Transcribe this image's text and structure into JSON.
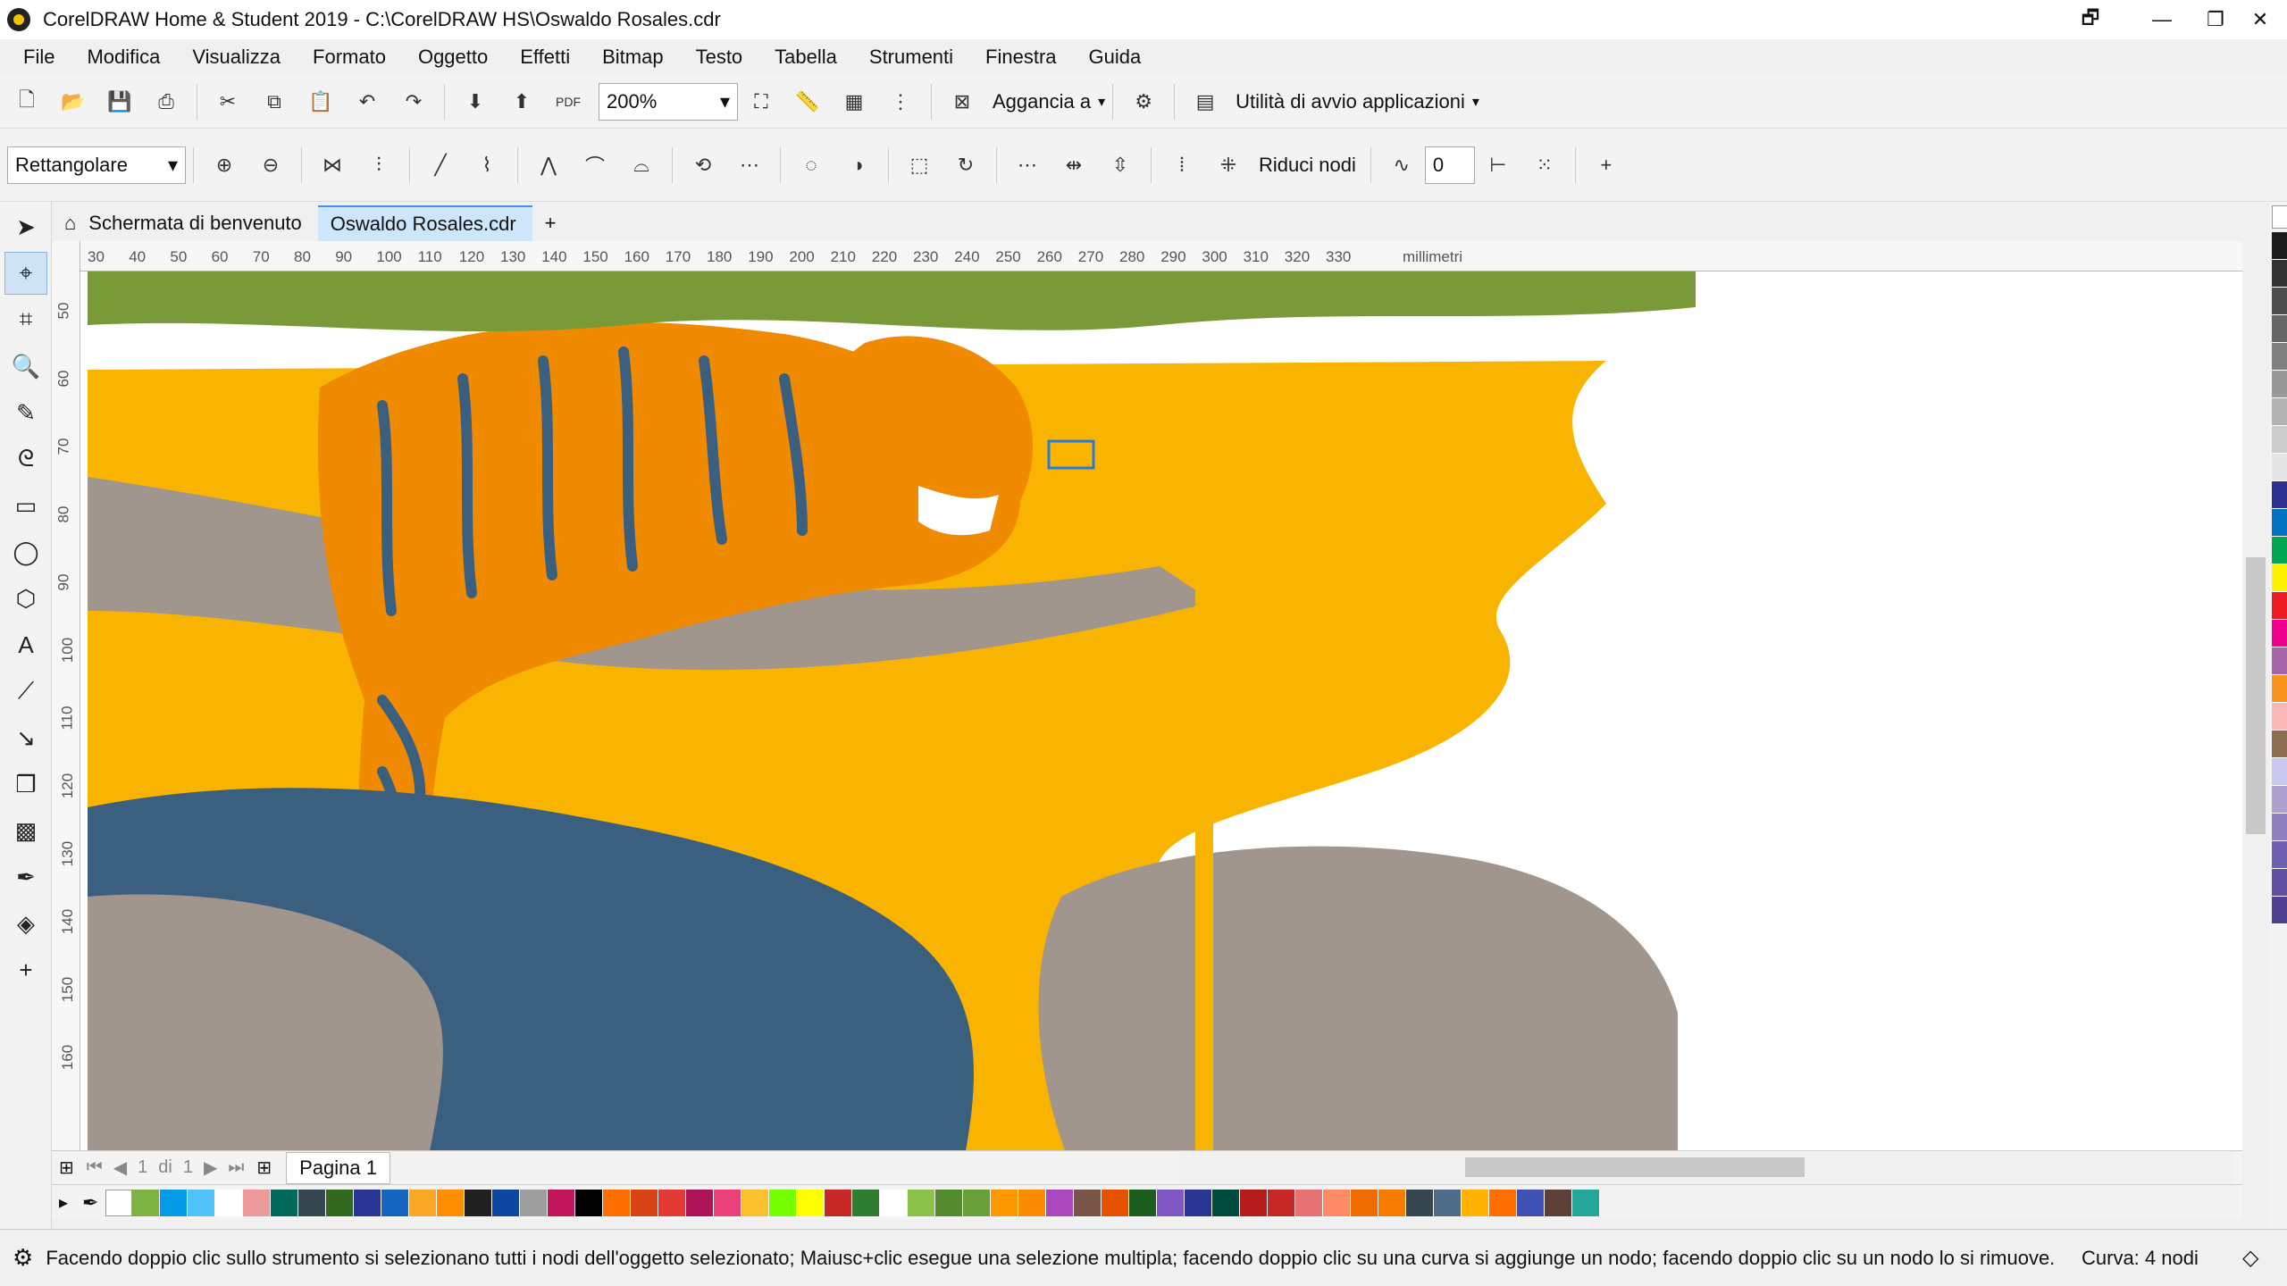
{
  "window": {
    "title": "CorelDRAW Home & Student 2019 - C:\\CorelDRAW HS\\Oswaldo Rosales.cdr"
  },
  "menu": [
    "File",
    "Modifica",
    "Visualizza",
    "Formato",
    "Oggetto",
    "Effetti",
    "Bitmap",
    "Testo",
    "Tabella",
    "Strumenti",
    "Finestra",
    "Guida"
  ],
  "toolbar": {
    "zoom": "200%",
    "snap_label": "Aggancia a",
    "launcher_label": "Utilità di avvio applicazioni",
    "pdf_label": "PDF"
  },
  "property_bar": {
    "selection_mode": "Rettangolare",
    "reduce_nodes_label": "Riduci nodi",
    "smoothing_value": "0"
  },
  "tabs": {
    "welcome": "Schermata di benvenuto",
    "document": "Oswaldo Rosales.cdr"
  },
  "rulers": {
    "h_ticks": [
      "30",
      "40",
      "50",
      "60",
      "70",
      "80",
      "90",
      "100",
      "110",
      "120",
      "130",
      "140",
      "150",
      "160",
      "170",
      "180",
      "190",
      "200",
      "210",
      "220",
      "230",
      "240",
      "250",
      "260",
      "270",
      "280",
      "290",
      "300",
      "310",
      "320",
      "330"
    ],
    "unit": "millimetri",
    "v_ticks": [
      "50",
      "60",
      "70",
      "80",
      "90",
      "100",
      "110",
      "120",
      "130",
      "140",
      "150",
      "160"
    ]
  },
  "page_nav": {
    "current": "1",
    "of_label": "di",
    "total": "1",
    "page_tab": "Pagina 1"
  },
  "status": {
    "message": "Facendo doppio clic sullo strumento si selezionano tutti i nodi dell'oggetto selezionato; Maiusc+clic esegue una selezione multipla; facendo doppio clic su una curva si aggiunge un nodo; facendo doppio clic su un nodo lo si rimuove.",
    "curve_info": "Curva: 4 nodi"
  },
  "colors": {
    "right_palette": [
      "#1a1a1a",
      "#333333",
      "#4d4d4d",
      "#666666",
      "#808080",
      "#999999",
      "#b3b3b3",
      "#cccccc",
      "#e6e6e6",
      "#2e3192",
      "#0071bc",
      "#00a651",
      "#fff200",
      "#ed1c24",
      "#ec008c",
      "#a864a8",
      "#f7941d",
      "#f9b7b7",
      "#8c6d4f",
      "#c8c8f0",
      "#b0a0d0",
      "#9080c0",
      "#7060b0",
      "#6050a0",
      "#504090"
    ],
    "doc_palette": [
      "#7cb342",
      "#039be5",
      "#4fc3f7",
      "#ffffff",
      "#ef9a9a",
      "#00695c",
      "#37474f",
      "#33691e",
      "#283593",
      "#1565c0",
      "#f9a825",
      "#ff8f00",
      "#212121",
      "#0d47a1",
      "#9e9e9e",
      "#c2185b",
      "#000000",
      "#ff6f00",
      "#d84315",
      "#e53935",
      "#ad1457",
      "#ec407a",
      "#fbc02d",
      "#76ff03",
      "#ffff00",
      "#c62828",
      "#2e7d32",
      "#ffffff",
      "#8bc34a",
      "#558b2f",
      "#689f38",
      "#ff9800",
      "#fb8c00",
      "#ab47bc",
      "#795548",
      "#e65100",
      "#1b5e20",
      "#7e57c2",
      "#283593",
      "#004d40",
      "#b71c1c",
      "#c62828",
      "#e57373",
      "#ff8a65",
      "#ef6c00",
      "#f57c00",
      "#37474f",
      "#4e6b8a",
      "#ffb300",
      "#ff6f00",
      "#3f51b5",
      "#5d4037",
      "#26a69a"
    ]
  }
}
